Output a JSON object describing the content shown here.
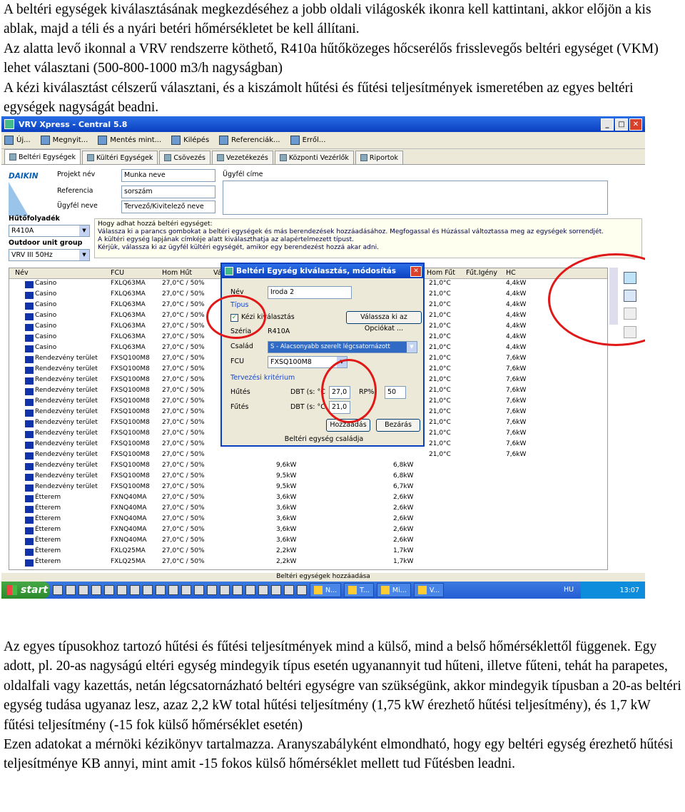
{
  "intro": [
    "A beltéri egységek kiválasztásának megkezdéséhez a jobb oldali világoskék ikonra kell kattintani, akkor előjön a kis ablak, majd a téli és a nyári betéri hőmérsékletet be kell állítani.",
    "Az alatta levő ikonnal a VRV rendszerre köthető, R410a hűtőközeges hőcserélős frisslevegős beltéri egységet (VKM) lehet választani (500-800-1000 m3/h nagyságban)",
    "A kézi kiválasztást célszerű választani, és a kiszámolt hűtési és fűtési teljesítmények ismeretében az egyes beltéri egységek nagyságát beadni."
  ],
  "outro": [
    "Az egyes típusokhoz tartozó hűtési és fűtési teljesítmények mind a külső, mind a belső hőmérséklettől függenek. Egy adott, pl. 20-as nagyságú eltéri egység mindegyik típus esetén ugyanannyit tud hűteni, illetve fűteni, tehát ha parapetes, oldalfali vagy kazettás, netán légcsatornázható beltéri egységre van szükségünk, akkor mindegyik típusban a 20-as beltéri egység tudása ugyanaz lesz, azaz 2,2 kW total hűtési teljesítmény (1,75 kW érezhető hűtési teljesítmény), és 1,7 kW fűtési teljesítmény (-15 fok külső hőmérséklet esetén)",
    "Ezen adatokat a mérnöki kézikönyv tartalmazza. Aranyszabályként elmondható, hogy egy beltéri egység érezhető hűtési teljesítménye KB annyi, mint amit -15 fokos külső hőmérséklet mellett tud Fűtésben leadni."
  ],
  "app": {
    "title": "VRV Xpress - Central 5.8",
    "toolbar": [
      "Új...",
      "Megnyit...",
      "Mentés mint...",
      "Kilépés",
      "Referenciák...",
      "Erről..."
    ],
    "tabs": [
      "Beltéri Egységek",
      "Kültéri Egységek",
      "Csövezés",
      "Vezetékezés",
      "Központi Vezérlők",
      "Riportok"
    ],
    "logo": "DAIKIN",
    "project_label": "Projekt név",
    "project_value": "Munka neve",
    "reference_label": "Referencia",
    "reference_value": "sorszám",
    "client_label": "Ügyfél neve",
    "client_value": "Tervező/Kivitelező neve",
    "address_label": "Ügyfél címe",
    "refrigerant_label": "Hűtőfolyadék",
    "refrigerant_value": "R410A",
    "outdoor_group_label": "Outdoor unit group",
    "outdoor_group_value": "VRV III 50Hz",
    "help_title": "Hogy adhat hozzá beltéri egységet:",
    "help_lines": [
      "Válassza ki a parancs gombokat a beltéri egységek és más berendezések hozzáadásához. Megfogassal és Húzással változtassa meg az egységek sorrendjét.",
      "A kültéri egység lapjának címkéje alatt kiválaszthatja az alapértelmezett típust.",
      "Kérjük, válassza ki az ügyfél kültéri egységét, amikor egy berendezést hozzá akar adni."
    ],
    "columns": [
      "Név",
      "FCU",
      "Hom Hűt",
      "Választ",
      "Hom Fűt",
      "Fűt.Igény",
      "HC"
    ],
    "rows": [
      [
        "Casino",
        "FXLQ63MA",
        "27,0°C / 50%",
        "21,0°C",
        "4,4kW"
      ],
      [
        "Casino",
        "FXLQ63MA",
        "27,0°C / 50%",
        "21,0°C",
        "4,4kW"
      ],
      [
        "Casino",
        "FXLQ63MA",
        "27,0°C / 50%",
        "21,0°C",
        "4,4kW"
      ],
      [
        "Casino",
        "FXLQ63MA",
        "27,0°C / 50%",
        "21,0°C",
        "4,4kW"
      ],
      [
        "Casino",
        "FXLQ63MA",
        "27,0°C / 50%",
        "21,0°C",
        "4,4kW"
      ],
      [
        "Casino",
        "FXLQ63MA",
        "27,0°C / 50%",
        "21,0°C",
        "4,4kW"
      ],
      [
        "Casino",
        "FXLQ63MA",
        "27,0°C / 50%",
        "21,0°C",
        "4,4kW"
      ],
      [
        "Rendezvény terület",
        "FXSQ100M8",
        "27,0°C / 50%",
        "21,0°C",
        "7,6kW"
      ],
      [
        "Rendezvény terület",
        "FXSQ100M8",
        "27,0°C / 50%",
        "21,0°C",
        "7,6kW"
      ],
      [
        "Rendezvény terület",
        "FXSQ100M8",
        "27,0°C / 50%",
        "21,0°C",
        "7,6kW"
      ],
      [
        "Rendezvény terület",
        "FXSQ100M8",
        "27,0°C / 50%",
        "21,0°C",
        "7,6kW"
      ],
      [
        "Rendezvény terület",
        "FXSQ100M8",
        "27,0°C / 50%",
        "21,0°C",
        "7,6kW"
      ],
      [
        "Rendezvény terület",
        "FXSQ100M8",
        "27,0°C / 50%",
        "21,0°C",
        "7,6kW"
      ],
      [
        "Rendezvény terület",
        "FXSQ100M8",
        "27,0°C / 50%",
        "21,0°C",
        "7,6kW"
      ],
      [
        "Rendezvény terület",
        "FXSQ100M8",
        "27,0°C / 50%",
        "21,0°C",
        "7,6kW"
      ],
      [
        "Rendezvény terület",
        "FXSQ100M8",
        "27,0°C / 50%",
        "21,0°C",
        "7,6kW"
      ],
      [
        "Rendezvény terület",
        "FXSQ100M8",
        "27,0°C / 50%",
        "21,0°C",
        "7,6kW"
      ],
      [
        "Rendezvény terület",
        "FXSQ100M8",
        "27,0°C / 50%",
        "9,6kW",
        "6,8kW"
      ],
      [
        "Rendezvény terület",
        "FXSQ100M8",
        "27,0°C / 50%",
        "9,5kW",
        "6,8kW"
      ],
      [
        "Rendezvény terület",
        "FXSQ100M8",
        "27,0°C / 50%",
        "9,5kW",
        "6,7kW"
      ],
      [
        "Étterem",
        "FXNQ40MA",
        "27,0°C / 50%",
        "3,6kW",
        "2,6kW"
      ],
      [
        "Étterem",
        "FXNQ40MA",
        "27,0°C / 50%",
        "3,6kW",
        "2,6kW"
      ],
      [
        "Étterem",
        "FXNQ40MA",
        "27,0°C / 50%",
        "3,6kW",
        "2,6kW"
      ],
      [
        "Étterem",
        "FXNQ40MA",
        "27,0°C / 50%",
        "3,6kW",
        "2,6kW"
      ],
      [
        "Étterem",
        "FXNQ40MA",
        "27,0°C / 50%",
        "3,6kW",
        "2,6kW"
      ],
      [
        "Étterem",
        "FXLQ25MA",
        "27,0°C / 50%",
        "2,2kW",
        "1,7kW"
      ],
      [
        "Étterem",
        "FXLQ25MA",
        "27,0°C / 50%",
        "2,2kW",
        "1,7kW"
      ]
    ],
    "statusbar": "Beltéri egységek hozzáadása",
    "taskbar": {
      "start": "start",
      "tasks": [
        "N...",
        "T...",
        "Mi...",
        "V..."
      ],
      "lang": "HU",
      "clock": "13:07"
    },
    "dialog": {
      "title": "Beltéri Egység kiválasztás, módosítás",
      "name_label": "Név",
      "name_value": "Iroda 2",
      "type_group": "Típus",
      "manual_label": "Kézi kiválasztás",
      "choose_option_btn": "Válassza ki az Opciókat ...",
      "series_label": "Széria",
      "series_value": "R410A",
      "family_label": "Család",
      "family_value": "S - Alacsonyabb szerelt légcsatornázott",
      "fcu_label": "FCU",
      "fcu_value": "FXSQ100M8",
      "design_group": "Tervezési kritérium",
      "cooling_label": "Hűtés",
      "heating_label": "Fűtés",
      "dbt_label": "DBT (s: °C",
      "cooling_dbt": "27,0",
      "heating_dbt": "21,0",
      "rh_label": "RP%",
      "rh_value": "50",
      "add_btn": "Hozzáadás",
      "close_btn": "Bezárás",
      "family_btn": "Beltéri egység családja"
    }
  }
}
